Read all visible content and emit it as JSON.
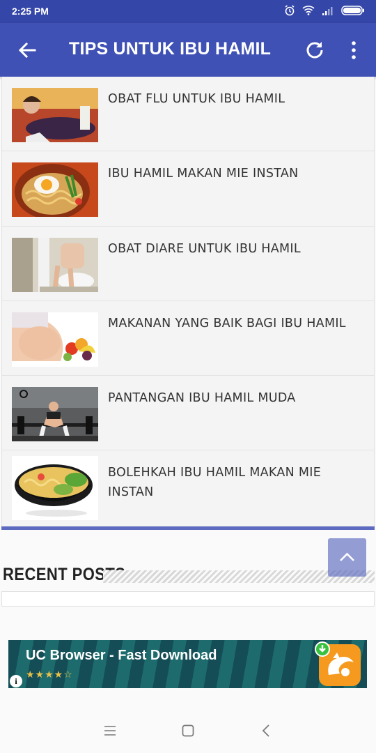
{
  "status_bar": {
    "time": "2:25 PM"
  },
  "app_bar": {
    "title": "TIPS UNTUK IBU HAMIL"
  },
  "articles": [
    {
      "title": "OBAT FLU UNTUK IBU HAMIL",
      "image": "pregnant-woman-with-flu"
    },
    {
      "title": "IBU HAMIL MAKAN MIE INSTAN",
      "image": "instant-noodle-bowl-with-egg"
    },
    {
      "title": "OBAT DIARE UNTUK IBU HAMIL",
      "image": "person-on-toilet"
    },
    {
      "title": "MAKANAN YANG BAIK BAGI IBU HAMIL",
      "image": "pregnant-belly-with-fruit"
    },
    {
      "title": "PANTANGAN IBU HAMIL MUDA",
      "image": "woman-lifting-barbell"
    },
    {
      "title": "BOLEHKAH IBU HAMIL MAKAN MIE INSTAN",
      "image": "noodle-bowl"
    }
  ],
  "recent_posts": {
    "heading": "RECENT POSTS"
  },
  "ad": {
    "title": "UC Browser - Fast Download",
    "rating": "★★★★☆",
    "info": "i"
  },
  "colors": {
    "primary": "#3f51b5",
    "status": "#3446a8",
    "accent": "#5c6bc0"
  }
}
